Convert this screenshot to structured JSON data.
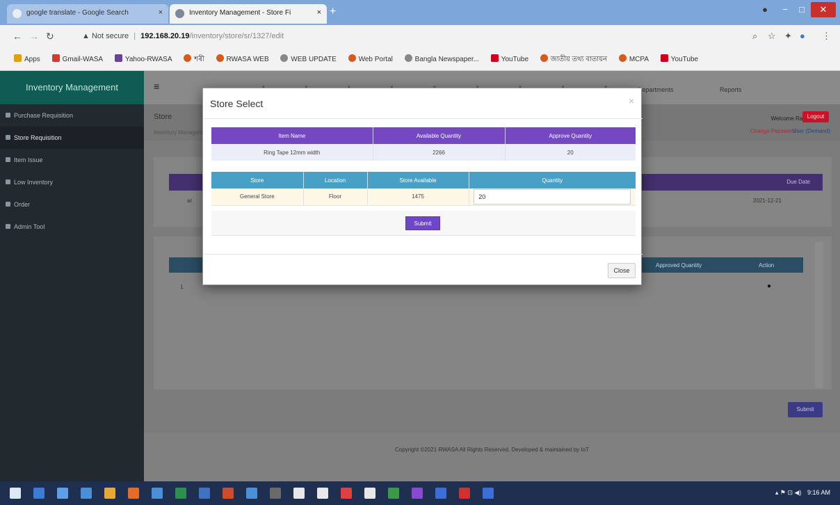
{
  "browser": {
    "tabs": [
      {
        "title": "google translate - Google Search",
        "close": "×"
      },
      {
        "title": "Inventory Management - Store Fi",
        "close": "×"
      }
    ],
    "new_tab": "+",
    "address": {
      "warning": "▲ Not secure",
      "separator": "|",
      "host": "192.168.20.19",
      "path": "/inventory/store/sr/1327/edit"
    },
    "bookmarks": [
      {
        "label": "Apps",
        "color": "#e0a010"
      },
      {
        "label": "Gmail-WASA",
        "color": "#d23b2d"
      },
      {
        "label": "Yahoo-RWASA",
        "color": "#6b3fa0"
      },
      {
        "label": "শৰী",
        "color": "#d85a1a"
      },
      {
        "label": "RWASA WEB",
        "color": "#d85a1a"
      },
      {
        "label": "WEB UPDATE",
        "color": "#888888"
      },
      {
        "label": "Web Portal",
        "color": "#d85a1a"
      },
      {
        "label": "Bangla Newspaper...",
        "color": "#888888"
      },
      {
        "label": "YouTube",
        "color": "#d0021b"
      },
      {
        "label": "জাতীয় তথ্য বাতায়ন",
        "color": "#d85a1a"
      },
      {
        "label": "MCPA",
        "color": "#d85a1a"
      },
      {
        "label": "YouTube",
        "color": "#d0021b"
      }
    ]
  },
  "app": {
    "brand": "Inventory Management",
    "sidebar": [
      {
        "label": "Purchase Requisition",
        "selected": false
      },
      {
        "label": "Store Requisition",
        "selected": true
      },
      {
        "label": "Item Issue",
        "selected": false
      },
      {
        "label": "Low Inventory",
        "selected": false
      },
      {
        "label": "Order",
        "selected": false
      },
      {
        "label": "Admin Tool",
        "selected": false
      }
    ],
    "topnav": {
      "hamburger": "≡",
      "departments": "Departments",
      "reports": "Reports"
    },
    "page": {
      "title": "Store",
      "breadcrumb": "Inventory Management",
      "welcome": "Welcome Raj",
      "logout": "Logout",
      "change_password": "Change Password",
      "user_info": "User (Demand)"
    },
    "card1": {
      "date_header": "Due Date",
      "row_value_left": "ar",
      "row_value_right": "2021-12-21"
    },
    "card2": {
      "approved_qty_header": "Approved Quantity",
      "action_header": "Action",
      "row_no": "1",
      "delete_icon": "●"
    },
    "submit_main": "Submit",
    "footer": "Copyright ©2021 RWASA All Rights Reserved. Developed & maintained by IoT"
  },
  "modal": {
    "title": "Store Select",
    "close_x": "×",
    "item_table": {
      "headers": [
        "Item Name",
        "Available Quantity",
        "Approve Quantity"
      ],
      "rows": [
        [
          "Ring Tape 12mm width",
          "2266",
          "20"
        ]
      ]
    },
    "store_table": {
      "headers": [
        "Store",
        "Location",
        "Store Available",
        "Quantity"
      ],
      "rows": [
        {
          "store": "General Store",
          "location": "Floor",
          "available": "1475",
          "quantity": "20"
        }
      ]
    },
    "submit_label": "Submit",
    "close_label": "Close"
  },
  "taskbar": {
    "icon_colors": [
      "#3a7bd5",
      "#5ea0e8",
      "#4a90d9",
      "#e8a838",
      "#e36c2b",
      "#4a90d9",
      "#2d8f4e",
      "#3f72c0",
      "#d04a2b",
      "#4a90d9",
      "#6a6a6a",
      "#e8e8e8",
      "#e8e8e8",
      "#e04040",
      "#e8e8e8",
      "#3a9a4a",
      "#8a4ad0",
      "#3b6ed8",
      "#d03030",
      "#3b6ed8"
    ],
    "tray": "▴ ⚑ ⊡ ◀)",
    "time": "9:16 AM"
  }
}
